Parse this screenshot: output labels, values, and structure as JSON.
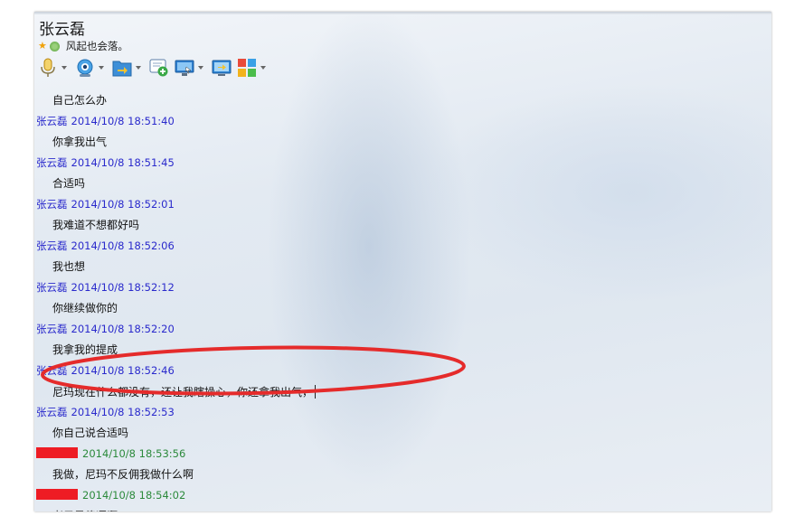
{
  "header": {
    "contact_name": "张云磊",
    "signature": "风起也会落。",
    "toolbar": [
      {
        "name": "microphone-icon",
        "has_menu": true
      },
      {
        "name": "webcam-icon",
        "has_menu": true
      },
      {
        "name": "send-file-icon",
        "has_menu": true
      },
      {
        "name": "add-conversation-icon",
        "has_menu": false
      },
      {
        "name": "remote-desktop-icon",
        "has_menu": true
      },
      {
        "name": "screen-share-icon",
        "has_menu": false
      },
      {
        "name": "apps-icon",
        "has_menu": true
      }
    ]
  },
  "messages": [
    {
      "sender": "",
      "time": "",
      "text": "自己怎么办"
    },
    {
      "sender": "张云磊",
      "time": "2014/10/8 18:51:40",
      "text": "你拿我出气"
    },
    {
      "sender": "张云磊",
      "time": "2014/10/8 18:51:45",
      "text": "合适吗"
    },
    {
      "sender": "张云磊",
      "time": "2014/10/8 18:52:01",
      "text": "我难道不想都好吗"
    },
    {
      "sender": "张云磊",
      "time": "2014/10/8 18:52:06",
      "text": "我也想"
    },
    {
      "sender": "张云磊",
      "time": "2014/10/8 18:52:12",
      "text": "你继续做你的"
    },
    {
      "sender": "张云磊",
      "time": "2014/10/8 18:52:20",
      "text": "我拿我的提成"
    },
    {
      "sender": "张云磊",
      "time": "2014/10/8 18:52:46",
      "text": "尼玛现在什么都没有，还让我瞎操心，你还拿我出气，"
    },
    {
      "sender": "张云磊",
      "time": "2014/10/8 18:52:53",
      "text": "你自己说合适吗"
    },
    {
      "sender": "",
      "time": "2014/10/8 18:53:56",
      "text": "我做，尼玛不反佣我做什么啊",
      "self": true
    },
    {
      "sender": "",
      "time": "2014/10/8 18:54:02",
      "text": "老子是傻逼啊",
      "self": true
    }
  ],
  "colors": {
    "other_sender": "#2a2acc",
    "self_sender": "#2c8a3c",
    "redaction": "#ee1c24",
    "annotation_ellipse": "#e52b2b"
  }
}
